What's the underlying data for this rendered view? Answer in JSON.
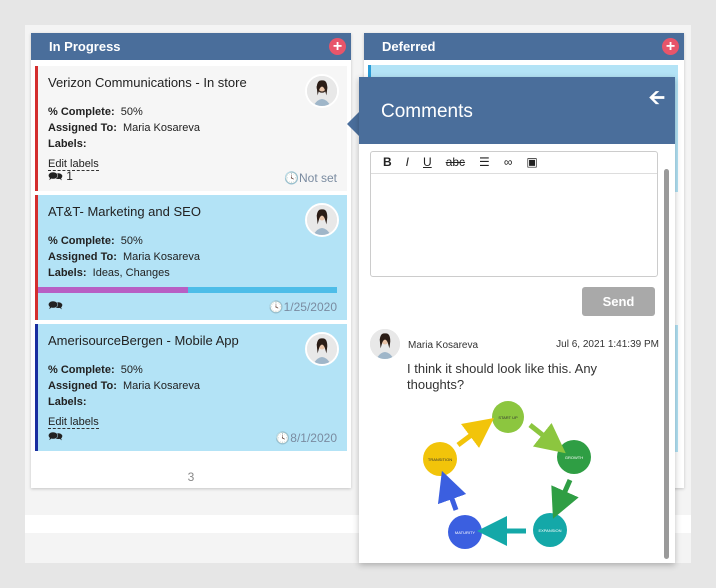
{
  "columns": [
    {
      "title": "In Progress",
      "add_label": "+",
      "count": "3",
      "cards": [
        {
          "title": "Verizon Communications - In store",
          "complete_label": "% Complete:",
          "complete_value": "50%",
          "assigned_label": "Assigned To:",
          "assigned_value": "Maria Kosareva",
          "labels_label": "Labels:",
          "labels_value": "",
          "edit_labels": "Edit labels",
          "comment_count": "1",
          "due": "Not set",
          "accent": "#d42e2e"
        },
        {
          "title": "AT&T- Marketing and SEO",
          "complete_label": "% Complete:",
          "complete_value": "50%",
          "assigned_label": "Assigned To:",
          "assigned_value": "Maria Kosareva",
          "labels_label": "Labels:",
          "labels_value": "Ideas, Changes",
          "comment_count": "",
          "due": "1/25/2020",
          "accent": "#d42e2e",
          "label_colors": [
            "#b85fc4",
            "#4dbde8"
          ]
        },
        {
          "title": "AmerisourceBergen - Mobile App",
          "complete_label": "% Complete:",
          "complete_value": "50%",
          "assigned_label": "Assigned To:",
          "assigned_value": "Maria Kosareva",
          "labels_label": "Labels:",
          "labels_value": "",
          "edit_labels": "Edit labels",
          "comment_count": "",
          "due": "8/1/2020",
          "accent": "#1a2fa0"
        }
      ]
    },
    {
      "title": "Deferred",
      "add_label": "+"
    }
  ],
  "comments": {
    "title": "Comments",
    "toolbar": [
      "B",
      "I",
      "U",
      "abc",
      "☰",
      "∞",
      "▣"
    ],
    "send_label": "Send",
    "items": [
      {
        "author": "Maria Kosareva",
        "date": "Jul 6, 2021 1:41:39 PM",
        "text": "I think it should look like this. Any thoughts?"
      }
    ]
  },
  "diagram_nodes": [
    "START UP",
    "GROWTH",
    "EXPANSION",
    "MATURITY",
    "TRANSITION"
  ],
  "colors": {
    "header": "#4a6e9b",
    "card_blue": "#b3e3f6",
    "add_button": "#e8556a"
  }
}
